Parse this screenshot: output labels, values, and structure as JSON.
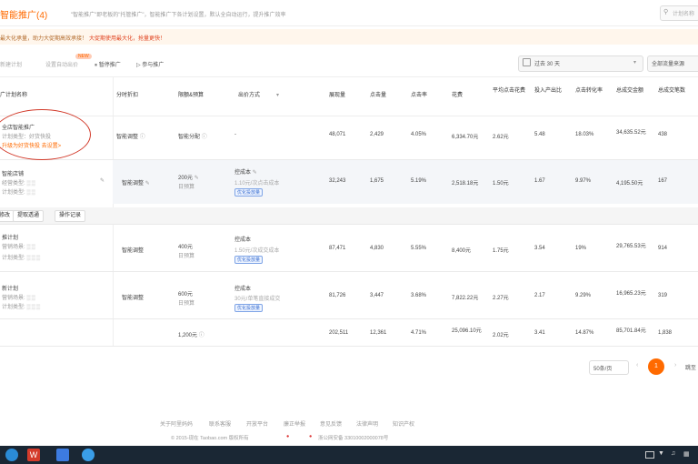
{
  "header": {
    "title": "智能推广(4)",
    "description": "\"智能推广\"即老板的\"托管推广\"，智能推广下各计划设置，默认全自动运行，提升推广效率",
    "search_placeholder": "计划名称"
  },
  "notice": {
    "text1": "最大化承量，助力大促期高效承接！",
    "text2": "大促期使用最大化，抢量更快！"
  },
  "toolbar": {
    "new_plan": "新建计划",
    "auto_settings": "设置自动出价",
    "new_badge": "NEW",
    "pause": "暂停推广",
    "participate": "参与推广",
    "date_range": "过去 30 天",
    "all_traffic": "全部流量来源"
  },
  "table": {
    "headers": [
      "广计划名称",
      "分时折扣",
      "限额&预算",
      "出价方式",
      "展现量",
      "点击量",
      "点击率",
      "花费",
      "平均点击花费",
      "投入产出比",
      "点击转化率",
      "总成交金额",
      "总成交笔数"
    ],
    "summary_row": {
      "name_line1": "全店智能推广",
      "name_line2": "计划类型：好货快投",
      "name_line3": "升级为好货快投 去设置>",
      "time_discount": "智能调整",
      "budget": "智能分配",
      "bid": "-",
      "impressions": "48,071",
      "clicks": "2,429",
      "ctr": "4.05%",
      "cost": "6,334.70元",
      "cpc": "2.62元",
      "roi": "5.48",
      "cvr": "18.03%",
      "gmv": "34,635.52元",
      "orders": "438"
    },
    "row2": {
      "name": "智能店铺",
      "sub1": "经营类型",
      "sub2": "计划类型",
      "time_discount": "智能调整",
      "budget": "200元",
      "budget_sub": "日预算",
      "bid": "控成本",
      "bid_sub": "1.10元/次点击成本",
      "bid_pill": "优化投放量",
      "impressions": "32,243",
      "clicks": "1,675",
      "ctr": "5.19%",
      "cost": "2,518.18元",
      "cpc": "1.50元",
      "roi": "1.67",
      "cvr": "9.97%",
      "gmv": "4,195.50元",
      "orders": "167"
    },
    "row3": {
      "name": "推计划",
      "sub1": "营销场景",
      "sub2": "计划类型",
      "time_discount": "智能调整",
      "budget": "400元",
      "budget_sub": "日预算",
      "bid": "控成本",
      "bid_sub": "1.50元/次成交成本",
      "bid_pill": "优化投放量",
      "impressions": "87,471",
      "clicks": "4,830",
      "ctr": "5.55%",
      "cost": "8,400元",
      "cpc": "1.75元",
      "roi": "3.54",
      "cvr": "19%",
      "gmv": "29,765.53元",
      "orders": "914"
    },
    "row4": {
      "name": "新计划",
      "sub1": "营销场景",
      "sub2": "计划类型",
      "time_discount": "智能调整",
      "budget": "600元",
      "budget_sub": "日预算",
      "bid": "控成本",
      "bid_sub": "30元/单笔直接成交",
      "bid_pill": "优化投放量",
      "impressions": "81,726",
      "clicks": "3,447",
      "ctr": "3.68%",
      "cost": "7,822.22元",
      "cpc": "2.27元",
      "roi": "2.17",
      "cvr": "9.29%",
      "gmv": "16,965.23元",
      "orders": "319"
    },
    "total": {
      "budget": "1,200元",
      "impressions": "202,511",
      "clicks": "12,361",
      "ctr": "4.71%",
      "cost": "25,096.10元",
      "cpc": "2.02元",
      "roi": "3.41",
      "cvr": "14.87%",
      "gmv": "85,701.84元",
      "orders": "1,838"
    },
    "sub_actions": [
      "修改",
      "提取透通",
      "操作记录"
    ]
  },
  "pagination": {
    "page_size": "50条/页",
    "current": "1",
    "jump_label": "跳至"
  },
  "footer": {
    "links": [
      "关于阿里妈妈",
      "联系客服",
      "开放平台",
      "廉正举报",
      "意见反馈",
      "法律声明",
      "知识产权"
    ],
    "copyright": "© 2015-现在 Taobao.com 版权所有",
    "icp": "浙公网安备 33010002000078号"
  },
  "colors": {
    "accent": "#ff6a00",
    "notice_bg": "#fff6ec",
    "annotation_red": "#d23a2a",
    "taskbar": "#1a2734"
  }
}
